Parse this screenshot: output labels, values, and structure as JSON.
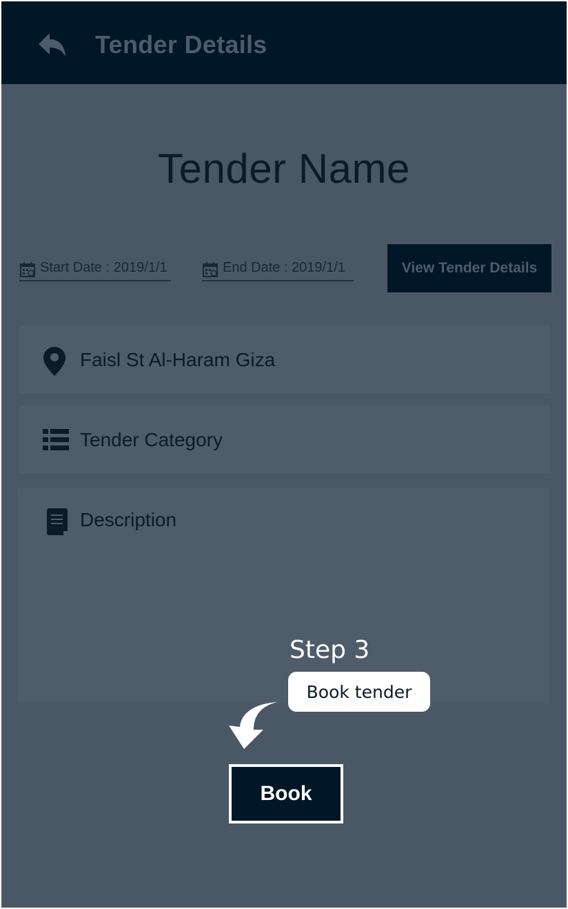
{
  "header": {
    "title": "Tender Details",
    "back_icon": "reply-arrow-icon"
  },
  "tender": {
    "name": "Tender Name",
    "start_date_label": "Start Date : 2019/1/1",
    "end_date_label": "End Date : 2019/1/1",
    "view_details_label": "View Tender Details",
    "location": "Faisl St Al-Haram Giza",
    "category": "Tender Category",
    "description": "Description"
  },
  "tutorial": {
    "step": "Step 3",
    "tooltip": "Book tender"
  },
  "actions": {
    "book_label": "Book"
  },
  "colors": {
    "header_bg": "#011627",
    "overlay_bg": "#4a5866",
    "field_bg": "#4f5c6a",
    "text_dark": "#0d1a28",
    "highlight": "#ffffff"
  }
}
